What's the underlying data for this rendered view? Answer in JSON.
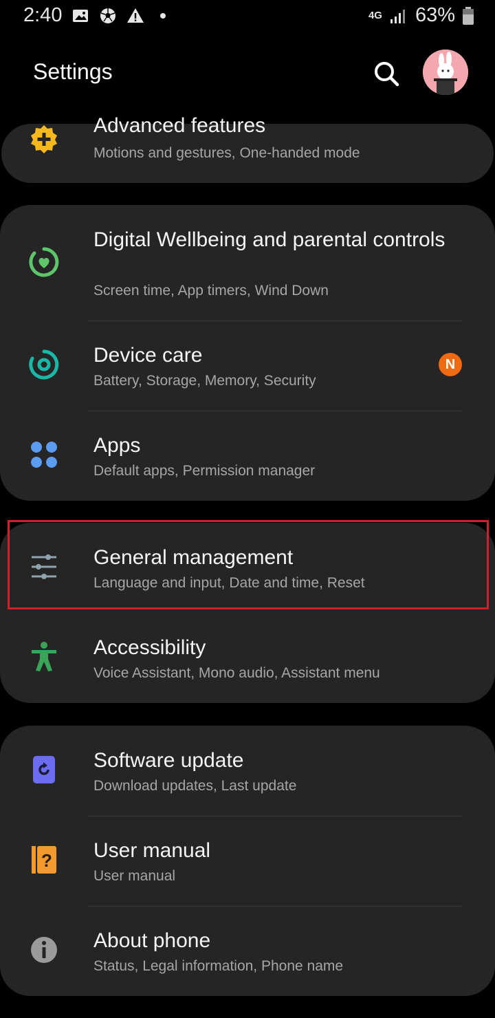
{
  "status_bar": {
    "time": "2:40",
    "network": "4G",
    "battery": "63%",
    "icons": [
      "image-icon",
      "soccer-ball-icon",
      "warning-icon",
      "dot-icon",
      "signal-icon",
      "battery-icon"
    ]
  },
  "header": {
    "title": "Settings",
    "search_icon": "search-icon",
    "avatar": "profile-avatar"
  },
  "items": [
    {
      "title": "Advanced features",
      "subtitle": "Motions and gestures, One-handed mode",
      "icon": "advanced-features-icon",
      "color": "#f5b91e"
    },
    {
      "title": "Digital Wellbeing and parental controls",
      "subtitle": "Screen time, App timers, Wind Down",
      "icon": "digital-wellbeing-icon",
      "color": "#5fc56a"
    },
    {
      "title": "Device care",
      "subtitle": "Battery, Storage, Memory, Security",
      "icon": "device-care-icon",
      "color": "#1ab7a6",
      "badge": "N"
    },
    {
      "title": "Apps",
      "subtitle": "Default apps, Permission manager",
      "icon": "apps-icon",
      "color": "#5b9bf0"
    },
    {
      "title": "General management",
      "subtitle": "Language and input, Date and time, Reset",
      "icon": "sliders-icon",
      "color": "#8fa2ad"
    },
    {
      "title": "Accessibility",
      "subtitle": "Voice Assistant, Mono audio, Assistant menu",
      "icon": "accessibility-icon",
      "color": "#3aa55a"
    },
    {
      "title": "Software update",
      "subtitle": "Download updates, Last update",
      "icon": "software-update-icon",
      "color": "#6c6cf0"
    },
    {
      "title": "User manual",
      "subtitle": "User manual",
      "icon": "user-manual-icon",
      "color": "#f29a2e"
    },
    {
      "title": "About phone",
      "subtitle": "Status, Legal information, Phone name",
      "icon": "info-icon",
      "color": "#9a9a9a"
    }
  ],
  "colors": {
    "background": "#000000",
    "card": "#252525",
    "highlight": "#d21f2b",
    "badge": "#f06a12"
  }
}
